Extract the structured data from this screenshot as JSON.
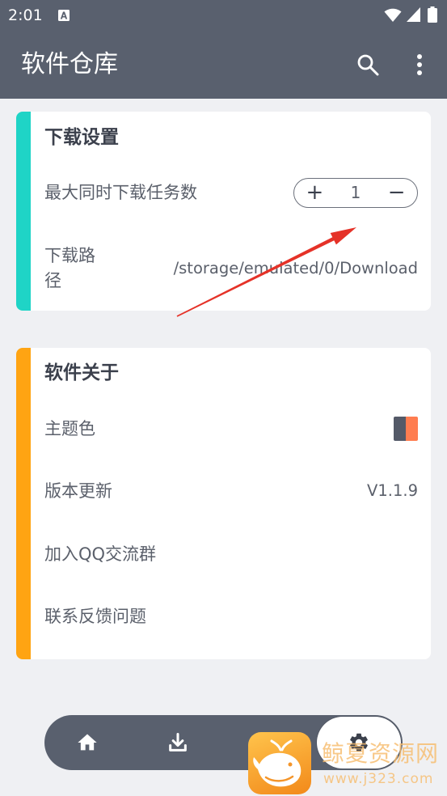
{
  "status_bar": {
    "time": "2:01",
    "icons": [
      "a-notification-icon",
      "wifi-icon",
      "signal-icon",
      "battery-icon"
    ]
  },
  "app_bar": {
    "title": "软件仓库",
    "actions": [
      "search-icon",
      "more-vert-icon"
    ]
  },
  "download_settings": {
    "title": "下载设置",
    "max_tasks": {
      "label": "最大同时下载任务数",
      "increment_label": "+",
      "value": "1",
      "decrement_label": "−"
    },
    "path": {
      "label": "下载路径",
      "value": "/storage/emulated/0/Download"
    }
  },
  "about": {
    "title": "软件关于",
    "theme_color": {
      "label": "主题色"
    },
    "update": {
      "label": "版本更新",
      "value": "V1.1.9"
    },
    "qq_group": {
      "label": "加入QQ交流群"
    },
    "feedback": {
      "label": "联系反馈问题"
    }
  },
  "bottom_nav": {
    "items": [
      {
        "icon": "home-icon",
        "active": false
      },
      {
        "icon": "download-icon",
        "active": false
      },
      {
        "icon": "settings-icon",
        "active": true
      }
    ]
  },
  "watermark": {
    "name": "鲸夏资源网",
    "url": "www.j323.com",
    "logo_icon": "whale-logo-icon"
  },
  "colors": {
    "primary": "#59606e",
    "background": "#eff0f3",
    "download_accent": "#1fd4c6",
    "about_accent": "#ffa412",
    "swatch_left": "#545a68",
    "swatch_right": "#ff7d50",
    "annotation_arrow": "#e53228"
  }
}
